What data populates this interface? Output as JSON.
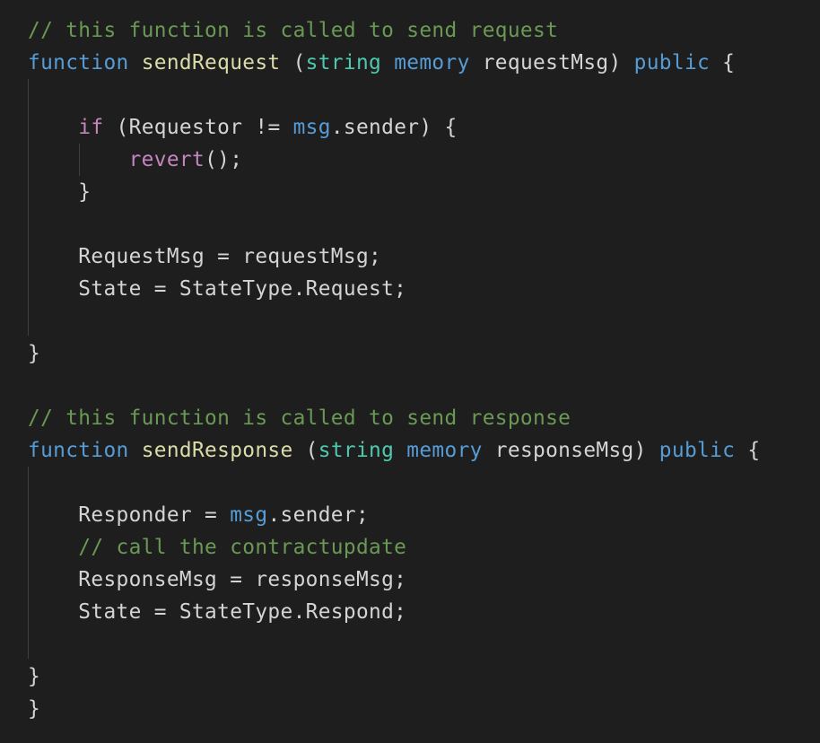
{
  "editor": {
    "theme_colors": {
      "background": "#1e1e1e",
      "comment": "#6a9955",
      "keyword": "#569cd6",
      "type": "#4ec9b0",
      "function": "#dcdcaa",
      "control": "#c586c0",
      "text": "#d4d4d4"
    },
    "lines": [
      {
        "tokens": [
          {
            "t": "// this function is called to send request",
            "c": "comment"
          }
        ]
      },
      {
        "tokens": [
          {
            "t": "function",
            "c": "keyword"
          },
          {
            "t": " ",
            "c": "ident"
          },
          {
            "t": "sendRequest",
            "c": "func"
          },
          {
            "t": " (",
            "c": "ident"
          },
          {
            "t": "string",
            "c": "type"
          },
          {
            "t": " ",
            "c": "ident"
          },
          {
            "t": "memory",
            "c": "keyword"
          },
          {
            "t": " requestMsg) ",
            "c": "ident"
          },
          {
            "t": "public",
            "c": "keyword"
          },
          {
            "t": " {",
            "c": "ident"
          }
        ]
      },
      {
        "tokens": []
      },
      {
        "tokens": [
          {
            "t": "    ",
            "c": "ident"
          },
          {
            "t": "if",
            "c": "control"
          },
          {
            "t": " (Requestor != ",
            "c": "ident"
          },
          {
            "t": "msg",
            "c": "builtin"
          },
          {
            "t": ".sender) {",
            "c": "ident"
          }
        ]
      },
      {
        "tokens": [
          {
            "t": "        ",
            "c": "ident"
          },
          {
            "t": "revert",
            "c": "control"
          },
          {
            "t": "();",
            "c": "ident"
          }
        ]
      },
      {
        "tokens": [
          {
            "t": "    }",
            "c": "ident"
          }
        ]
      },
      {
        "tokens": []
      },
      {
        "tokens": [
          {
            "t": "    RequestMsg = requestMsg;",
            "c": "ident"
          }
        ]
      },
      {
        "tokens": [
          {
            "t": "    State = StateType.Request;",
            "c": "ident"
          }
        ]
      },
      {
        "tokens": []
      },
      {
        "tokens": [
          {
            "t": "}",
            "c": "ident"
          }
        ]
      },
      {
        "tokens": []
      },
      {
        "tokens": [
          {
            "t": "// this function is called to send response",
            "c": "comment"
          }
        ]
      },
      {
        "tokens": [
          {
            "t": "function",
            "c": "keyword"
          },
          {
            "t": " ",
            "c": "ident"
          },
          {
            "t": "sendResponse",
            "c": "func"
          },
          {
            "t": " (",
            "c": "ident"
          },
          {
            "t": "string",
            "c": "type"
          },
          {
            "t": " ",
            "c": "ident"
          },
          {
            "t": "memory",
            "c": "keyword"
          },
          {
            "t": " responseMsg) ",
            "c": "ident"
          },
          {
            "t": "public",
            "c": "keyword"
          },
          {
            "t": " {",
            "c": "ident"
          }
        ]
      },
      {
        "tokens": []
      },
      {
        "tokens": [
          {
            "t": "    Responder = ",
            "c": "ident"
          },
          {
            "t": "msg",
            "c": "builtin"
          },
          {
            "t": ".sender;",
            "c": "ident"
          }
        ]
      },
      {
        "tokens": [
          {
            "t": "    ",
            "c": "ident"
          },
          {
            "t": "// call the contractupdate",
            "c": "comment"
          }
        ]
      },
      {
        "tokens": [
          {
            "t": "    ResponseMsg = responseMsg;",
            "c": "ident"
          }
        ]
      },
      {
        "tokens": [
          {
            "t": "    State = StateType.Respond;",
            "c": "ident"
          }
        ]
      },
      {
        "tokens": []
      },
      {
        "tokens": [
          {
            "t": "}",
            "c": "ident"
          }
        ]
      },
      {
        "tokens": [
          {
            "t": "}",
            "c": "ident"
          }
        ]
      }
    ]
  }
}
